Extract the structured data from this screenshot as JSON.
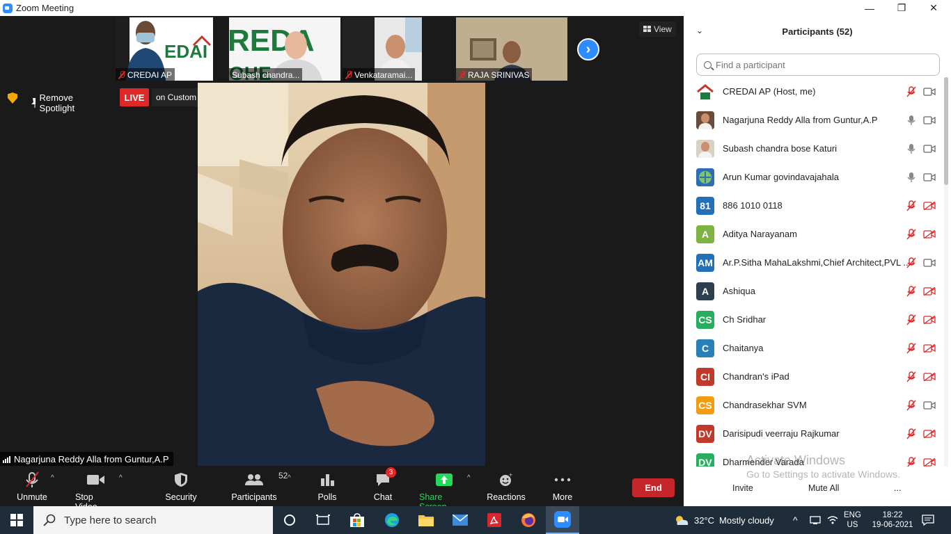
{
  "window": {
    "title": "Zoom Meeting",
    "minimize": "—",
    "maximize": "❐",
    "close": "✕"
  },
  "gallery": {
    "thumbs": [
      {
        "name": "CREDAI AP"
      },
      {
        "name": "Subash chandra..."
      },
      {
        "name": "Venkataramai..."
      },
      {
        "name": "RAJA SRINIVAS"
      }
    ],
    "next": "›",
    "view_label": "View"
  },
  "spotlight": {
    "remove_label": "Remove Spotlight",
    "live_badge": "LIVE",
    "live_text": "on Custom Live Streaming Service"
  },
  "speaker": {
    "name": "Nagarjuna Reddy Alla from Guntur,A.P"
  },
  "toolbar": {
    "unmute": "Unmute",
    "stop_video": "Stop Video",
    "security": "Security",
    "participants": "Participants",
    "participants_count": "52",
    "polls": "Polls",
    "chat": "Chat",
    "chat_badge": "3",
    "share_screen": "Share Screen",
    "reactions": "Reactions",
    "more": "More",
    "end": "End"
  },
  "panel": {
    "title": "Participants (52)",
    "search_placeholder": "Find a participant",
    "invite": "Invite",
    "mute_all": "Mute All",
    "more": "...",
    "participants": [
      {
        "name": "CREDAI AP (Host, me)",
        "avatar": "",
        "color": "#ffffff",
        "mic": "off",
        "cam": "on"
      },
      {
        "name": "Nagarjuna Reddy Alla from Guntur,A.P",
        "avatar": "",
        "color": "#6b4b3a",
        "mic": "on",
        "cam": "on"
      },
      {
        "name": "Subash chandra bose Katuri",
        "avatar": "",
        "color": "#d9d2c0",
        "mic": "on",
        "cam": "on"
      },
      {
        "name": "Arun Kumar govindavajahala",
        "avatar": "",
        "color": "#2f6db5",
        "mic": "on",
        "cam": "on"
      },
      {
        "name": "886 1010 0118",
        "avatar": "81",
        "color": "#2271b8",
        "mic": "off",
        "cam": "off"
      },
      {
        "name": "Aditya Narayanam",
        "avatar": "A",
        "color": "#7cb342",
        "mic": "off",
        "cam": "off"
      },
      {
        "name": "Ar.P.Sitha MahaLakshmi,Chief Architect,PVL ...",
        "avatar": "AM",
        "color": "#2271b8",
        "mic": "off",
        "cam": "on"
      },
      {
        "name": "Ashiqua",
        "avatar": "A",
        "color": "#2d3e50",
        "mic": "off",
        "cam": "off"
      },
      {
        "name": "Ch Sridhar",
        "avatar": "CS",
        "color": "#27ae60",
        "mic": "off",
        "cam": "off"
      },
      {
        "name": "Chaitanya",
        "avatar": "C",
        "color": "#2980b9",
        "mic": "off",
        "cam": "off"
      },
      {
        "name": "Chandran's iPad",
        "avatar": "CI",
        "color": "#c0392b",
        "mic": "off",
        "cam": "off"
      },
      {
        "name": "Chandrasekhar SVM",
        "avatar": "CS",
        "color": "#f39c12",
        "mic": "off",
        "cam": "on"
      },
      {
        "name": "Darisipudi veerraju Rajkumar",
        "avatar": "DV",
        "color": "#c0392b",
        "mic": "off",
        "cam": "off"
      },
      {
        "name": "Dharmender Varada",
        "avatar": "DV",
        "color": "#27ae60",
        "mic": "off",
        "cam": "off"
      }
    ]
  },
  "watermark": {
    "line1": "Activate Windows",
    "line2": "Go to Settings to activate Windows."
  },
  "taskbar": {
    "search_placeholder": "Type here to search",
    "weather_temp": "32°C",
    "weather_text": "Mostly cloudy",
    "lang": "ENG",
    "region": "US",
    "time": "18:22",
    "date": "19-06-2021"
  }
}
